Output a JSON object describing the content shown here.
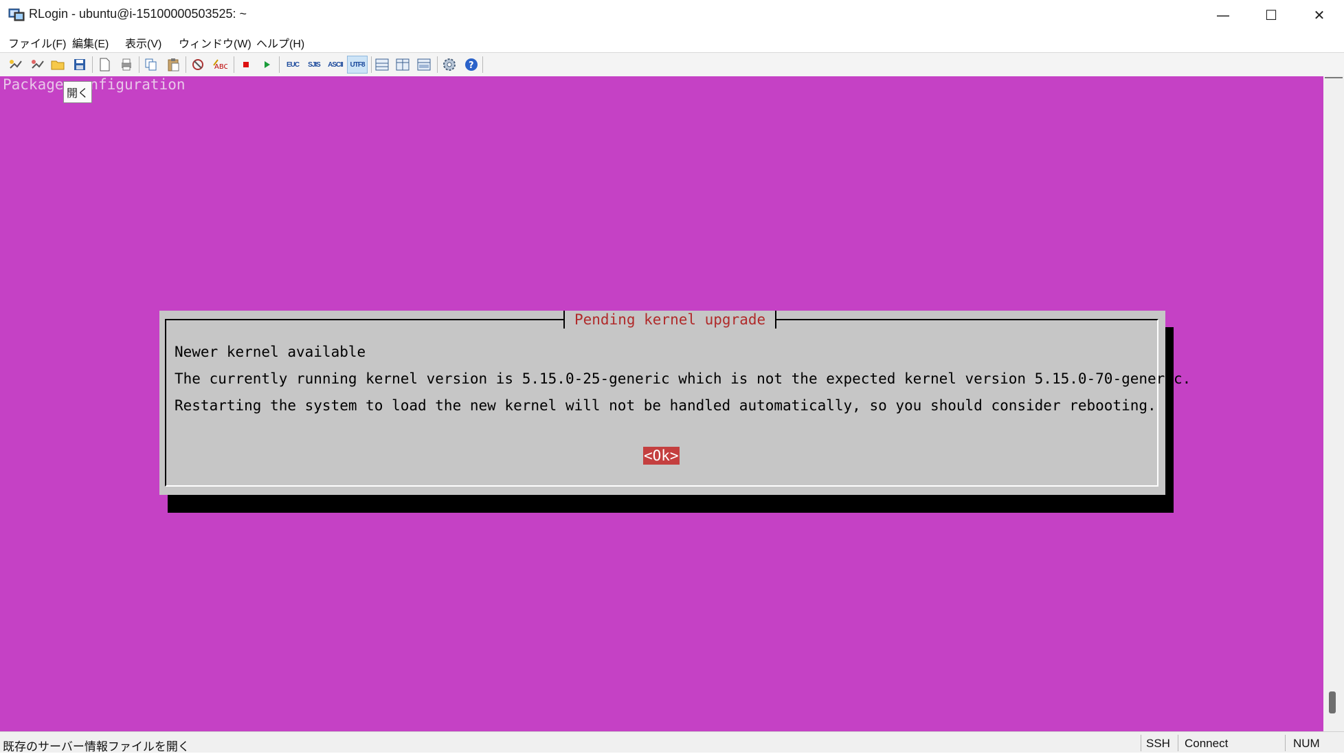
{
  "window": {
    "title": "RLogin - ubuntu@i-15100000503525: ~",
    "minimize_glyph": "—",
    "maximize_glyph": "☐",
    "close_glyph": "✕"
  },
  "menu": {
    "items": [
      "ファイル(F)",
      "編集(E)",
      "表示(V)",
      "ウィンドウ(W)",
      "ヘルプ(H)"
    ]
  },
  "toolbar": {
    "encodings": [
      "EUC",
      "SJIS",
      "ASCII",
      "UTF8"
    ],
    "active_encoding": "UTF8"
  },
  "terminal": {
    "first_line": "Package configuration",
    "background_color": "#c541c5"
  },
  "tooltip": {
    "text": "開く"
  },
  "dialog": {
    "title": "Pending kernel upgrade",
    "heading": "Newer kernel available",
    "line1": "The currently running kernel version is 5.15.0-25-generic which is not the expected kernel version 5.15.0-70-generic.",
    "line2": "Restarting the system to load the new kernel will not be handled automatically, so you should consider rebooting.",
    "ok_label": "<Ok>"
  },
  "statusbar": {
    "message": "既存のサーバー情報ファイルを開く",
    "protocol": "SSH",
    "state": "Connect",
    "numlock": "NUM"
  }
}
